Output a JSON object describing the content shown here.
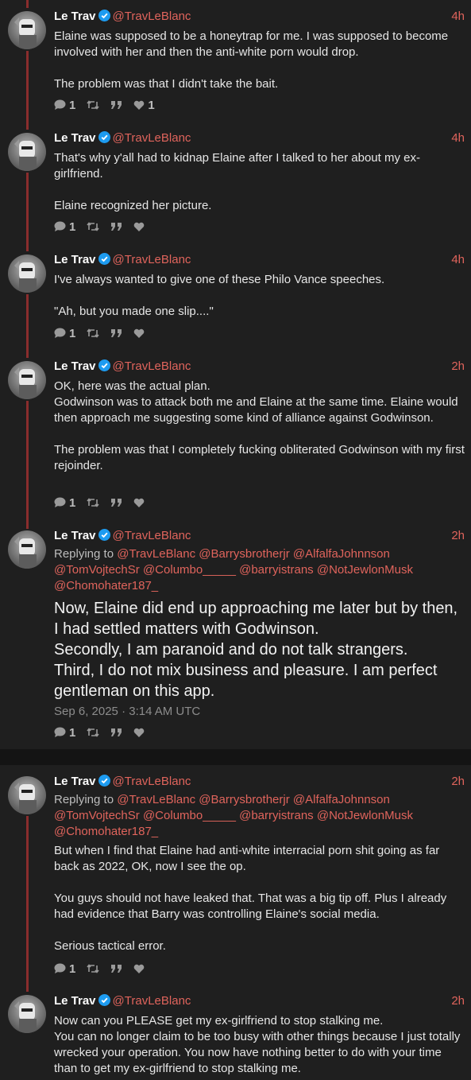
{
  "author": {
    "name": "Le Trav",
    "handle": "@TravLeBlanc"
  },
  "posts": [
    {
      "time": "4h",
      "lines": [
        "Elaine was supposed to be a honeytrap for me. I was supposed to become involved with her and then the anti-white porn would drop.",
        "The problem was that I didn't take the bait."
      ],
      "replies": "1",
      "likes": "1"
    },
    {
      "time": "4h",
      "lines": [
        "That's why y'all had to kidnap Elaine after I talked to her about my ex-girlfriend.",
        "Elaine recognized her picture."
      ],
      "replies": "1",
      "likes": ""
    },
    {
      "time": "4h",
      "lines": [
        "I've always wanted to give one of these Philo Vance speeches.",
        "\"Ah, but you made one slip....\""
      ],
      "replies": "1",
      "likes": ""
    },
    {
      "time": "2h",
      "lines": [
        "OK, here was the actual plan.",
        "Godwinson was to attack both me and Elaine at the same time. Elaine would then approach me suggesting some kind of alliance against Godwinson.",
        "The problem was that I completely fucking obliterated Godwinson with my first rejoinder."
      ],
      "replies": "1",
      "likes": ""
    },
    {
      "time": "2h",
      "replying_label": "Replying to",
      "mentions": [
        "@TravLeBlanc",
        "@Barrysbrotherjr",
        "@AlfalfaJohnnson",
        "@TomVojtechSr",
        "@Columbo_____",
        "@barryistrans",
        "@NotJewlonMusk",
        "@Chomohater187_"
      ],
      "lines": [
        "Now, Elaine did end up approaching me later but by then, I had settled matters with Godwinson.",
        "Secondly, I am paranoid and do not talk strangers.",
        "Third, I do not mix business and pleasure. I am perfect gentleman on this app."
      ],
      "date": "Sep 6, 2025 · 3:14 AM UTC",
      "replies": "1",
      "likes": ""
    },
    {
      "time": "2h",
      "replying_label": "Replying to",
      "mentions": [
        "@TravLeBlanc",
        "@Barrysbrotherjr",
        "@AlfalfaJohnnson",
        "@TomVojtechSr",
        "@Columbo_____",
        "@barryistrans",
        "@NotJewlonMusk",
        "@Chomohater187_"
      ],
      "lines": [
        "But when I find that Elaine had anti-white interracial porn shit going as far back as 2022, OK, now I see the op.",
        "You guys should not have leaked that. That was a big tip off. Plus I already had evidence that Barry was controlling Elaine's social media.",
        "Serious tactical error."
      ],
      "replies": "1",
      "likes": ""
    },
    {
      "time": "2h",
      "lines": [
        "Now can you PLEASE get my ex-girlfriend to stop stalking me.",
        "You can no longer claim to be too busy with other things because I just totally wrecked your operation. You now have nothing better to do with your time than to get my ex-girlfriend to stop stalking me."
      ]
    }
  ],
  "colors": {
    "accent": "#e0645c",
    "background": "#1f1f1f",
    "thread": "#8a2d2d",
    "verified": "#1d9bf0"
  }
}
